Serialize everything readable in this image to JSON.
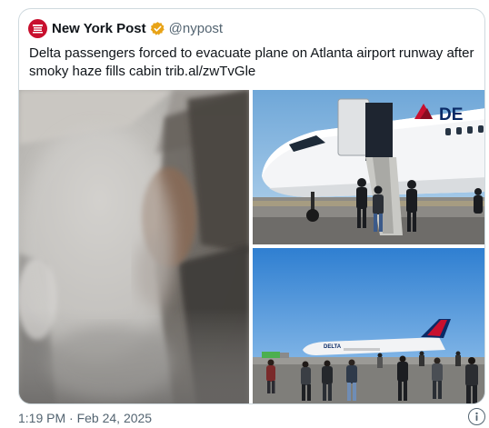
{
  "author": {
    "name": "New York Post",
    "handle": "@nypost",
    "avatar_icon": "nypost-logo-icon",
    "verified_icon": "verified-badge-icon",
    "brand_color": "#c8102e",
    "verified_color": "#e8a317"
  },
  "tweet": {
    "text": "Delta passengers forced to evacuate plane on Atlanta airport runway after smoky haze fills cabin trib.al/zwTvGle"
  },
  "media": {
    "images": [
      {
        "subject": "smoke-filled-cabin"
      },
      {
        "subject": "plane-door-evacuation"
      },
      {
        "subject": "passengers-on-runway"
      }
    ]
  },
  "plane_livery": {
    "nose_text": "DE",
    "fuselage_text": "DELTA",
    "accent": "#c8102e",
    "navy": "#0a2a66"
  },
  "footer": {
    "timestamp": "1:19 PM · Feb 24, 2025",
    "info_icon": "info-icon"
  }
}
